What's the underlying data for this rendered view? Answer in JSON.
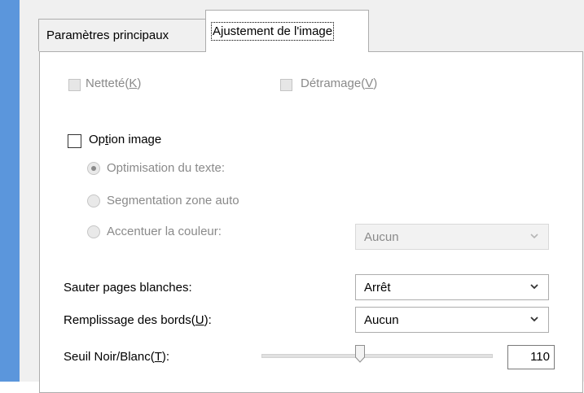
{
  "tabs": [
    {
      "label": "Paramètres principaux",
      "active": false
    },
    {
      "label": "Ajustement de l'image",
      "active": true
    }
  ],
  "sharpness": {
    "label": "Netteté(",
    "mnemonic": "K",
    "suffix": ")",
    "checked": false,
    "enabled": false
  },
  "descreening": {
    "label": "Détramage(",
    "mnemonic": "V",
    "suffix": ")",
    "checked": false,
    "enabled": false
  },
  "image_option": {
    "label_pre": "Op",
    "label_mnemonic": "t",
    "label_post": "ion image",
    "checked": false
  },
  "radios": [
    {
      "label": "Optimisation du texte:",
      "selected": true,
      "enabled": false
    },
    {
      "label": "Segmentation zone auto",
      "selected": false,
      "enabled": false
    },
    {
      "label": "Accentuer la couleur:",
      "selected": false,
      "enabled": false
    }
  ],
  "color_select": {
    "value": "Aucun",
    "enabled": false
  },
  "skip_blank": {
    "label": "Sauter pages blanches:",
    "value": "Arrêt"
  },
  "edge_fill": {
    "label_pre": "Remplissage des bords(",
    "mnemonic": "U",
    "label_post": "):",
    "value": "Aucun"
  },
  "threshold": {
    "label_pre": "Seuil Noir/Blanc(",
    "mnemonic": "T",
    "label_post": "):",
    "value": "110",
    "slider_fraction": 0.43
  },
  "colors": {
    "accent_strip": "#5b96dc",
    "dialog_bg": "#f0f0f0",
    "disabled_text": "#8a8a8a"
  }
}
